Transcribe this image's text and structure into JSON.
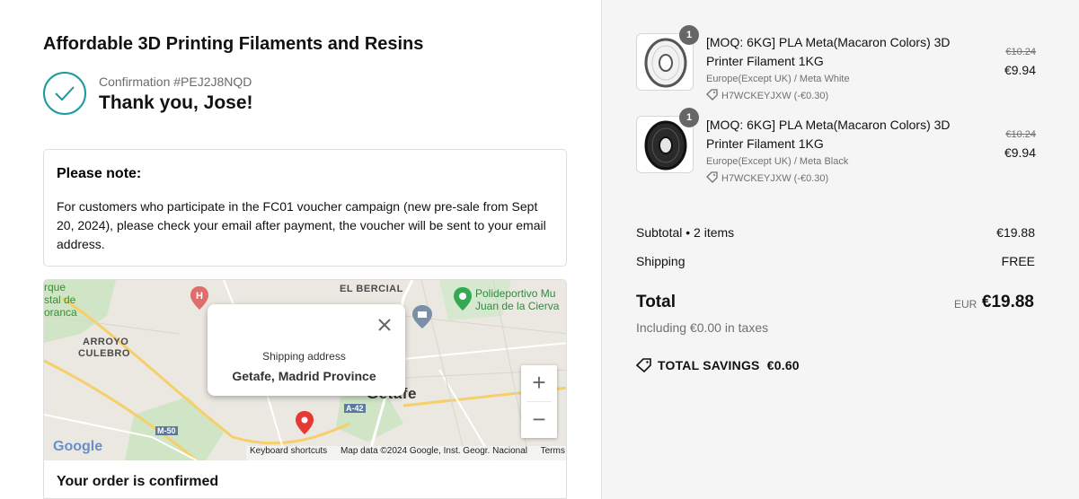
{
  "shop": {
    "title": "Affordable 3D Printing Filaments and Resins"
  },
  "confirmation": {
    "number": "Confirmation #PEJ2J8NQD",
    "thanks": "Thank you, Jose!"
  },
  "note": {
    "title": "Please note:",
    "text": "For customers who participate in the FC01 voucher campaign (new pre-sale from Sept 20, 2024), please check your email after payment, the voucher will be sent to your email address."
  },
  "map": {
    "labels": {
      "el_bercial": "EL BERCIAL",
      "arroyo": "ARROYO",
      "culebro": "CULEBRO",
      "getafe": "Getafe",
      "polideportivo1": "Polideportivo Mu",
      "polideportivo2": "Juan de la Cierva",
      "parque1": "rque",
      "parque2": "stal de",
      "parque3": "oranca",
      "a42": "A-42",
      "m50": "M-50"
    },
    "popup": {
      "label": "Shipping address",
      "value": "Getafe, Madrid Province"
    },
    "zoom_in": "+",
    "zoom_out": "−",
    "footer": {
      "shortcuts": "Keyboard shortcuts",
      "data": "Map data ©2024 Google, Inst. Geogr. Nacional",
      "terms": "Terms"
    },
    "logo": "Google"
  },
  "order_status": "Your order is confirmed",
  "summary": {
    "items": [
      {
        "qty": "1",
        "name": "[MOQ: 6KG] PLA Meta(Macaron Colors) 3D Printer Filament 1KG",
        "variant": "Europe(Except UK) / Meta White",
        "discount": "H7WCKEYJXW (-€0.30)",
        "price_old": "€10.24",
        "price_new": "€9.94",
        "spool_color": "#f2f2f2"
      },
      {
        "qty": "1",
        "name": "[MOQ: 6KG] PLA Meta(Macaron Colors) 3D Printer Filament 1KG",
        "variant": "Europe(Except UK) / Meta Black",
        "discount": "H7WCKEYJXW (-€0.30)",
        "price_old": "€10.24",
        "price_new": "€9.94",
        "spool_color": "#2a2a2a"
      }
    ],
    "subtotal_label": "Subtotal • 2 items",
    "subtotal_value": "€19.88",
    "shipping_label": "Shipping",
    "shipping_value": "FREE",
    "total_label": "Total",
    "total_currency": "EUR",
    "total_value": "€19.88",
    "taxes": "Including €0.00 in taxes",
    "savings": "TOTAL SAVINGS  €0.60"
  },
  "colors": {
    "accent": "#1a9b9b",
    "summary_bg": "#f5f5f5",
    "map_pin": "#e53935"
  }
}
